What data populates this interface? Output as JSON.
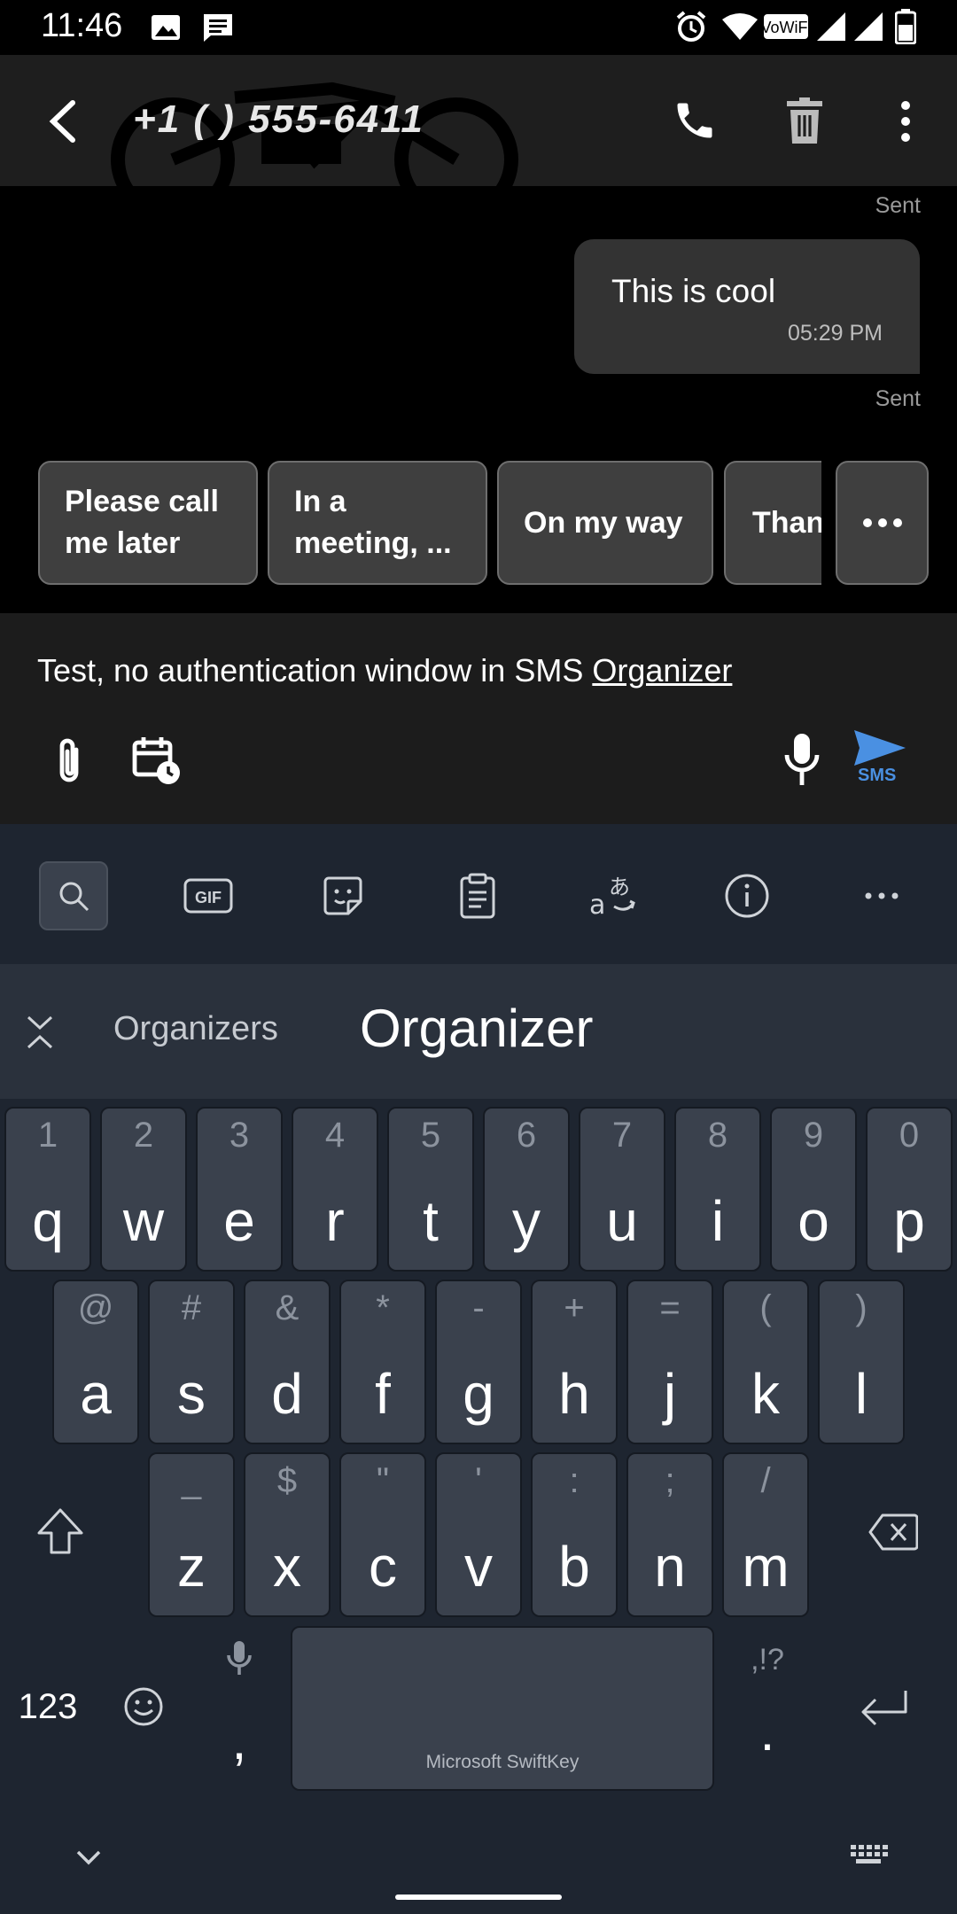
{
  "status_bar": {
    "time": "11:46"
  },
  "header": {
    "contact": "+1 (   ) 555-6411"
  },
  "conversation": {
    "sent_label_top": "Sent",
    "message": {
      "text": "This is cool",
      "time": "05:29 PM"
    },
    "sent_label_bottom": "Sent"
  },
  "quick_replies": [
    "Please call me later",
    "In a meeting, ...",
    "On my way",
    "Than"
  ],
  "compose": {
    "draft_prefix": "Test, no authentication window in SMS ",
    "draft_underlined": "Organizer",
    "send_label": "SMS"
  },
  "keyboard": {
    "suggestions": [
      "Organizers",
      "Organizer"
    ],
    "row1": [
      [
        "1",
        "q"
      ],
      [
        "2",
        "w"
      ],
      [
        "3",
        "e"
      ],
      [
        "4",
        "r"
      ],
      [
        "5",
        "t"
      ],
      [
        "6",
        "y"
      ],
      [
        "7",
        "u"
      ],
      [
        "8",
        "i"
      ],
      [
        "9",
        "o"
      ],
      [
        "0",
        "p"
      ]
    ],
    "row2": [
      [
        "@",
        "a"
      ],
      [
        "#",
        "s"
      ],
      [
        "&",
        "d"
      ],
      [
        "*",
        "f"
      ],
      [
        "-",
        "g"
      ],
      [
        "+",
        "h"
      ],
      [
        "=",
        "j"
      ],
      [
        "(",
        "k"
      ],
      [
        ")",
        "l"
      ]
    ],
    "row3": [
      [
        "_",
        "z"
      ],
      [
        "$",
        "x"
      ],
      [
        "\"",
        "c"
      ],
      [
        "'",
        "v"
      ],
      [
        ":",
        "b"
      ],
      [
        ";",
        "n"
      ],
      [
        "/",
        "m"
      ]
    ],
    "num_label": "123",
    "comma": ",",
    "period": ".",
    "period_hint": ",!?",
    "space_label": "Microsoft SwiftKey"
  }
}
